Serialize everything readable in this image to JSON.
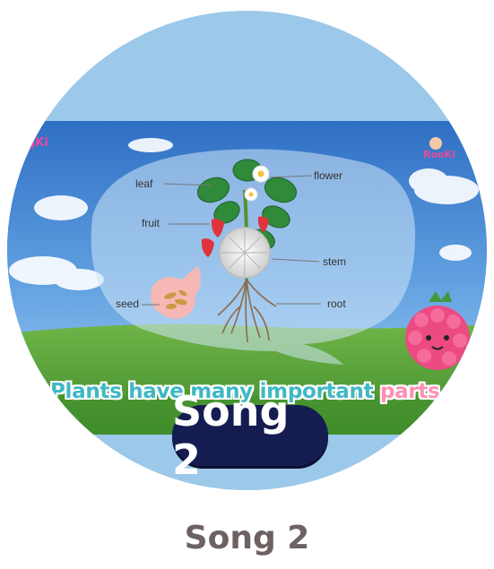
{
  "thumbnail": {
    "brand_left": "gKi",
    "brand_right": "RooKi",
    "labels": {
      "leaf": "leaf",
      "flower": "flower",
      "fruit": "fruit",
      "stem": "stem",
      "seed": "seed",
      "root": "root"
    },
    "subtitle_main": "Plants have many important ",
    "subtitle_highlight": "parts",
    "badge": "Song 2"
  },
  "caption": "Song 2",
  "colors": {
    "sky": "#6aa7e0",
    "grass": "#5fa33a",
    "badge_bg": "#151c52",
    "subtitle_teal": "#3fb8c4",
    "subtitle_pink": "#ff8fb2",
    "caption": "#6e6162"
  }
}
